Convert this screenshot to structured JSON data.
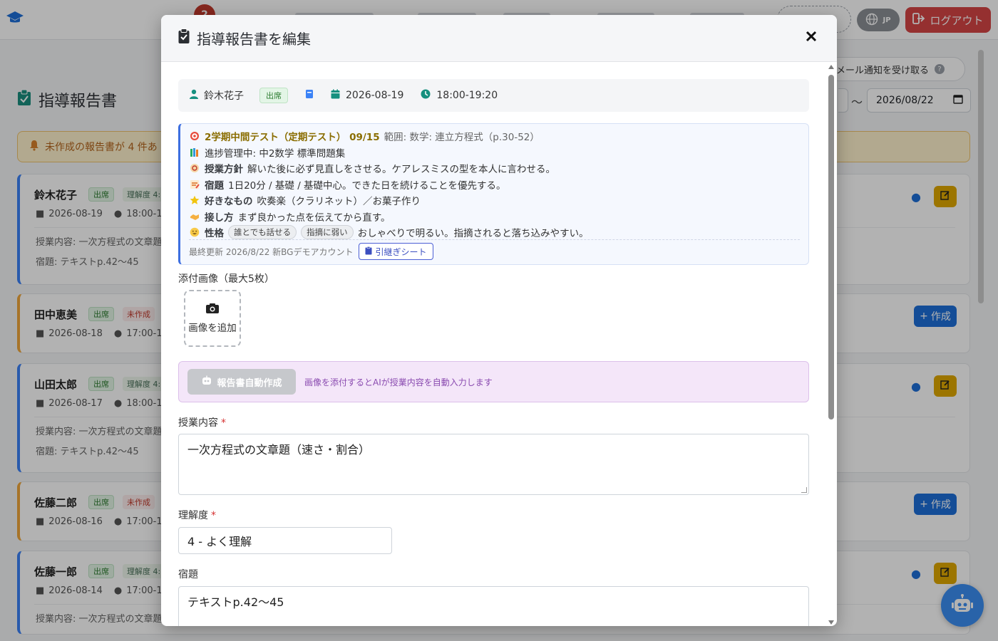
{
  "header": {
    "nav_badge": "2",
    "lang": "JP",
    "logout_label": "ログアウト"
  },
  "page": {
    "title": "指導報告書",
    "mail_toggle_label": "メール通知を受け取る",
    "date_sep": "〜",
    "date_to": "2026/08/22",
    "alert_text": "未作成の報告書が 4 件あ"
  },
  "cards": [
    {
      "name": "鈴木花子",
      "attendance": "出席",
      "status": "理解度 4:",
      "date": "2026-08-19",
      "time": "18:00-1",
      "content": "授業内容: 一次方程式の文章題",
      "homework": "宿題: テキストp.42〜45"
    },
    {
      "name": "田中恵美",
      "attendance": "出席",
      "status": "未作成",
      "date": "2026-08-18",
      "time": "17:00-1",
      "create_label": "作成"
    },
    {
      "name": "山田太郎",
      "attendance": "出席",
      "status": "理解度 4:",
      "date": "2026-08-17",
      "time": "18:00-1",
      "content": "授業内容: 一次方程式の文章題",
      "homework": "宿題: テキストp.42〜45"
    },
    {
      "name": "佐藤二郎",
      "attendance": "出席",
      "status": "未作成",
      "date": "2026-08-16",
      "time": "17:00-1",
      "create_label": "作成"
    },
    {
      "name": "佐藤一郎",
      "attendance": "出席",
      "status": "理解度 4:",
      "date": "2026-08-14",
      "time": "17:00-1",
      "content": "授業内容: 一次方程式の文章題"
    }
  ],
  "modal": {
    "title": "指導報告書を編集",
    "student": "鈴木花子",
    "attendance": "出席",
    "date": "2026-08-19",
    "time": "18:00-19:20",
    "handover": {
      "exam_title": "2学期中間テスト（定期テスト） 09/15",
      "exam_range": "範囲: 数学: 連立方程式（p.30-52）",
      "progress": "進捗管理中: 中2数学 標準問題集",
      "policy_label": "授業方針",
      "policy": "解いた後に必ず見直しをさせる。ケアレスミスの型を本人に言わせる。",
      "homework_label": "宿題",
      "homework": "1日20分 / 基礎 / 基礎中心。できた日を続けることを優先する。",
      "likes_label": "好きなもの",
      "likes": "吹奏楽（クラリネット）／お菓子作り",
      "approach_label": "接し方",
      "approach": "まず良かった点を伝えてから直す。",
      "personality_label": "性格",
      "tag1": "誰とでも話せる",
      "tag2": "指摘に弱い",
      "personality": "おしゃべりで明るい。指摘されると落ち込みやすい。",
      "updated": "最終更新 2026/8/22 新BGデモアカウント",
      "sheet_button": "引継ぎシート"
    },
    "images_label": "添付画像（最大5枚）",
    "add_image": "画像を追加",
    "ai_button": "報告書自動作成",
    "ai_hint": "画像を添付するとAIが授業内容を自動入力します",
    "content_label": "授業内容",
    "required_mark": "*",
    "content_value": "一次方程式の文章題（速さ・割合）",
    "understanding_label": "理解度",
    "understanding_value": "4 - よく理解",
    "homework_label": "宿題",
    "homework_value": "テキストp.42〜45"
  },
  "colors": {
    "primary": "#1e6fd9",
    "teal": "#16907f",
    "danger": "#d64545",
    "warning": "#e0a800",
    "ai_bg": "#f4e6f9"
  }
}
